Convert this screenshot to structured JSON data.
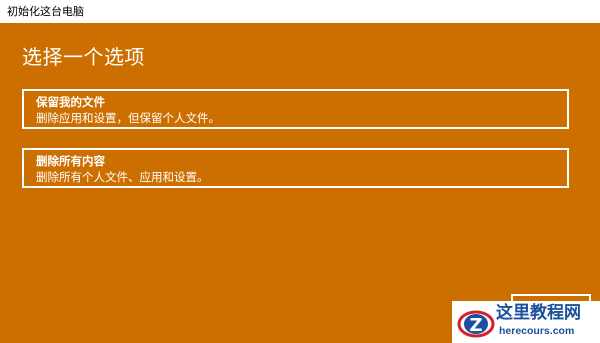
{
  "window": {
    "title": "初始化这台电脑"
  },
  "main": {
    "heading": "选择一个选项",
    "options": [
      {
        "title": "保留我的文件",
        "description": "删除应用和设置，但保留个人文件。"
      },
      {
        "title": "删除所有内容",
        "description": "删除所有个人文件、应用和设置。"
      }
    ]
  },
  "watermark": {
    "name": "这里教程网",
    "url": "herecours.com",
    "logo_letter": "Z"
  },
  "colors": {
    "panel_background": "#cc6f00",
    "text": "#ffffff",
    "watermark_blue": "#1c4f9c",
    "watermark_red": "#d2232a"
  },
  "icons": {
    "watermark_logo": "z-logo-icon"
  }
}
